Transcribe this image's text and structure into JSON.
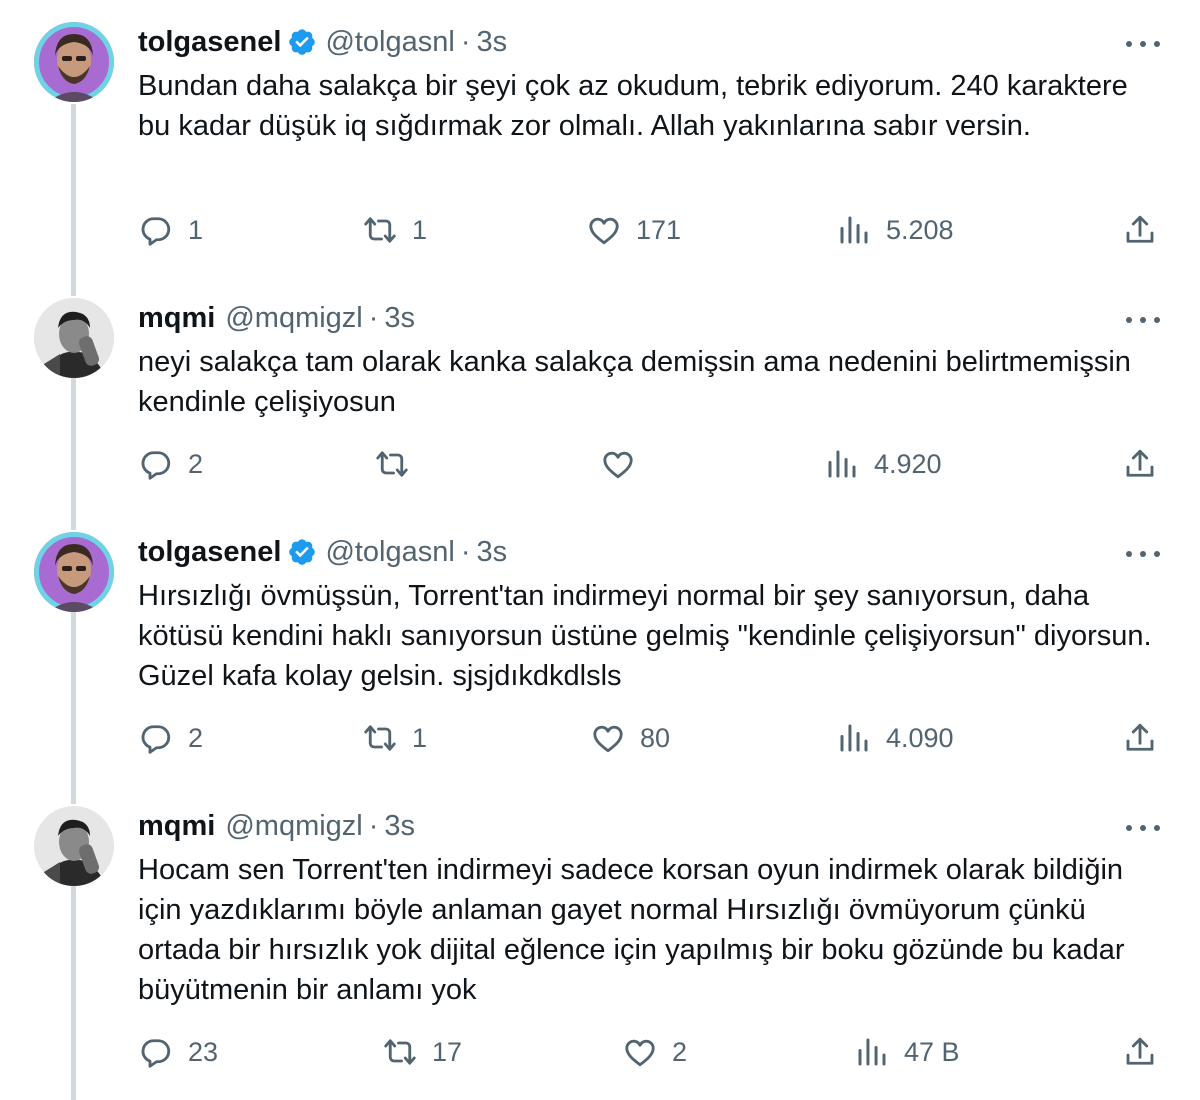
{
  "tweets": [
    {
      "display_name": "tolgasenel",
      "handle": "@tolgasnl",
      "separator": "·",
      "age": "3s",
      "verified": true,
      "text": "Bundan daha salakça bir şeyi çok az okudum, tebrik ediyorum. 240 karaktere bu kadar düşük iq sığdırmak zor olmalı. Allah yakınlarına sabır versin.",
      "replies": "1",
      "retweets": "1",
      "likes": "171",
      "views": "5.208"
    },
    {
      "display_name": "mqmi",
      "handle": "@mqmigzl",
      "separator": "·",
      "age": "3s",
      "verified": false,
      "text": "neyi salakça tam olarak kanka salakça demişsin ama nedenini belirtmemişsin kendinle çelişiyosun",
      "replies": "2",
      "retweets": "",
      "likes": "",
      "views": "4.920"
    },
    {
      "display_name": "tolgasenel",
      "handle": "@tolgasnl",
      "separator": "·",
      "age": "3s",
      "verified": true,
      "text": "Hırsızlığı övmüşsün, Torrent'tan indirmeyi normal bir şey sanıyorsun, daha kötüsü kendini haklı sanıyorsun üstüne gelmiş \"kendinle çelişiyorsun\" diyorsun. Güzel kafa kolay gelsin. sjsjdıkdkdlsls",
      "replies": "2",
      "retweets": "1",
      "likes": "80",
      "views": "4.090"
    },
    {
      "display_name": "mqmi",
      "handle": "@mqmigzl",
      "separator": "·",
      "age": "3s",
      "verified": false,
      "text": "Hocam sen Torrent'ten indirmeyi sadece korsan oyun indirmek olarak bildiğin için yazdıklarımı böyle anlaman gayet normal Hırsızlığı övmüyorum çünkü ortada bir hırsızlık yok dijital eğlence için yapılmış bir boku gözünde bu kadar büyütmenin bir anlamı yok",
      "replies": "23",
      "retweets": "17",
      "likes": "2",
      "views": "47 B"
    }
  ],
  "icons": {
    "reply": "reply-icon",
    "retweet": "retweet-icon",
    "like": "like-icon",
    "views": "views-icon",
    "share": "share-icon",
    "more": "more-icon",
    "verified": "verified-badge-icon"
  },
  "colors": {
    "text": "#0f1419",
    "secondary": "#536471",
    "verified": "#1d9bf0",
    "thread_line": "#cfd9de"
  }
}
